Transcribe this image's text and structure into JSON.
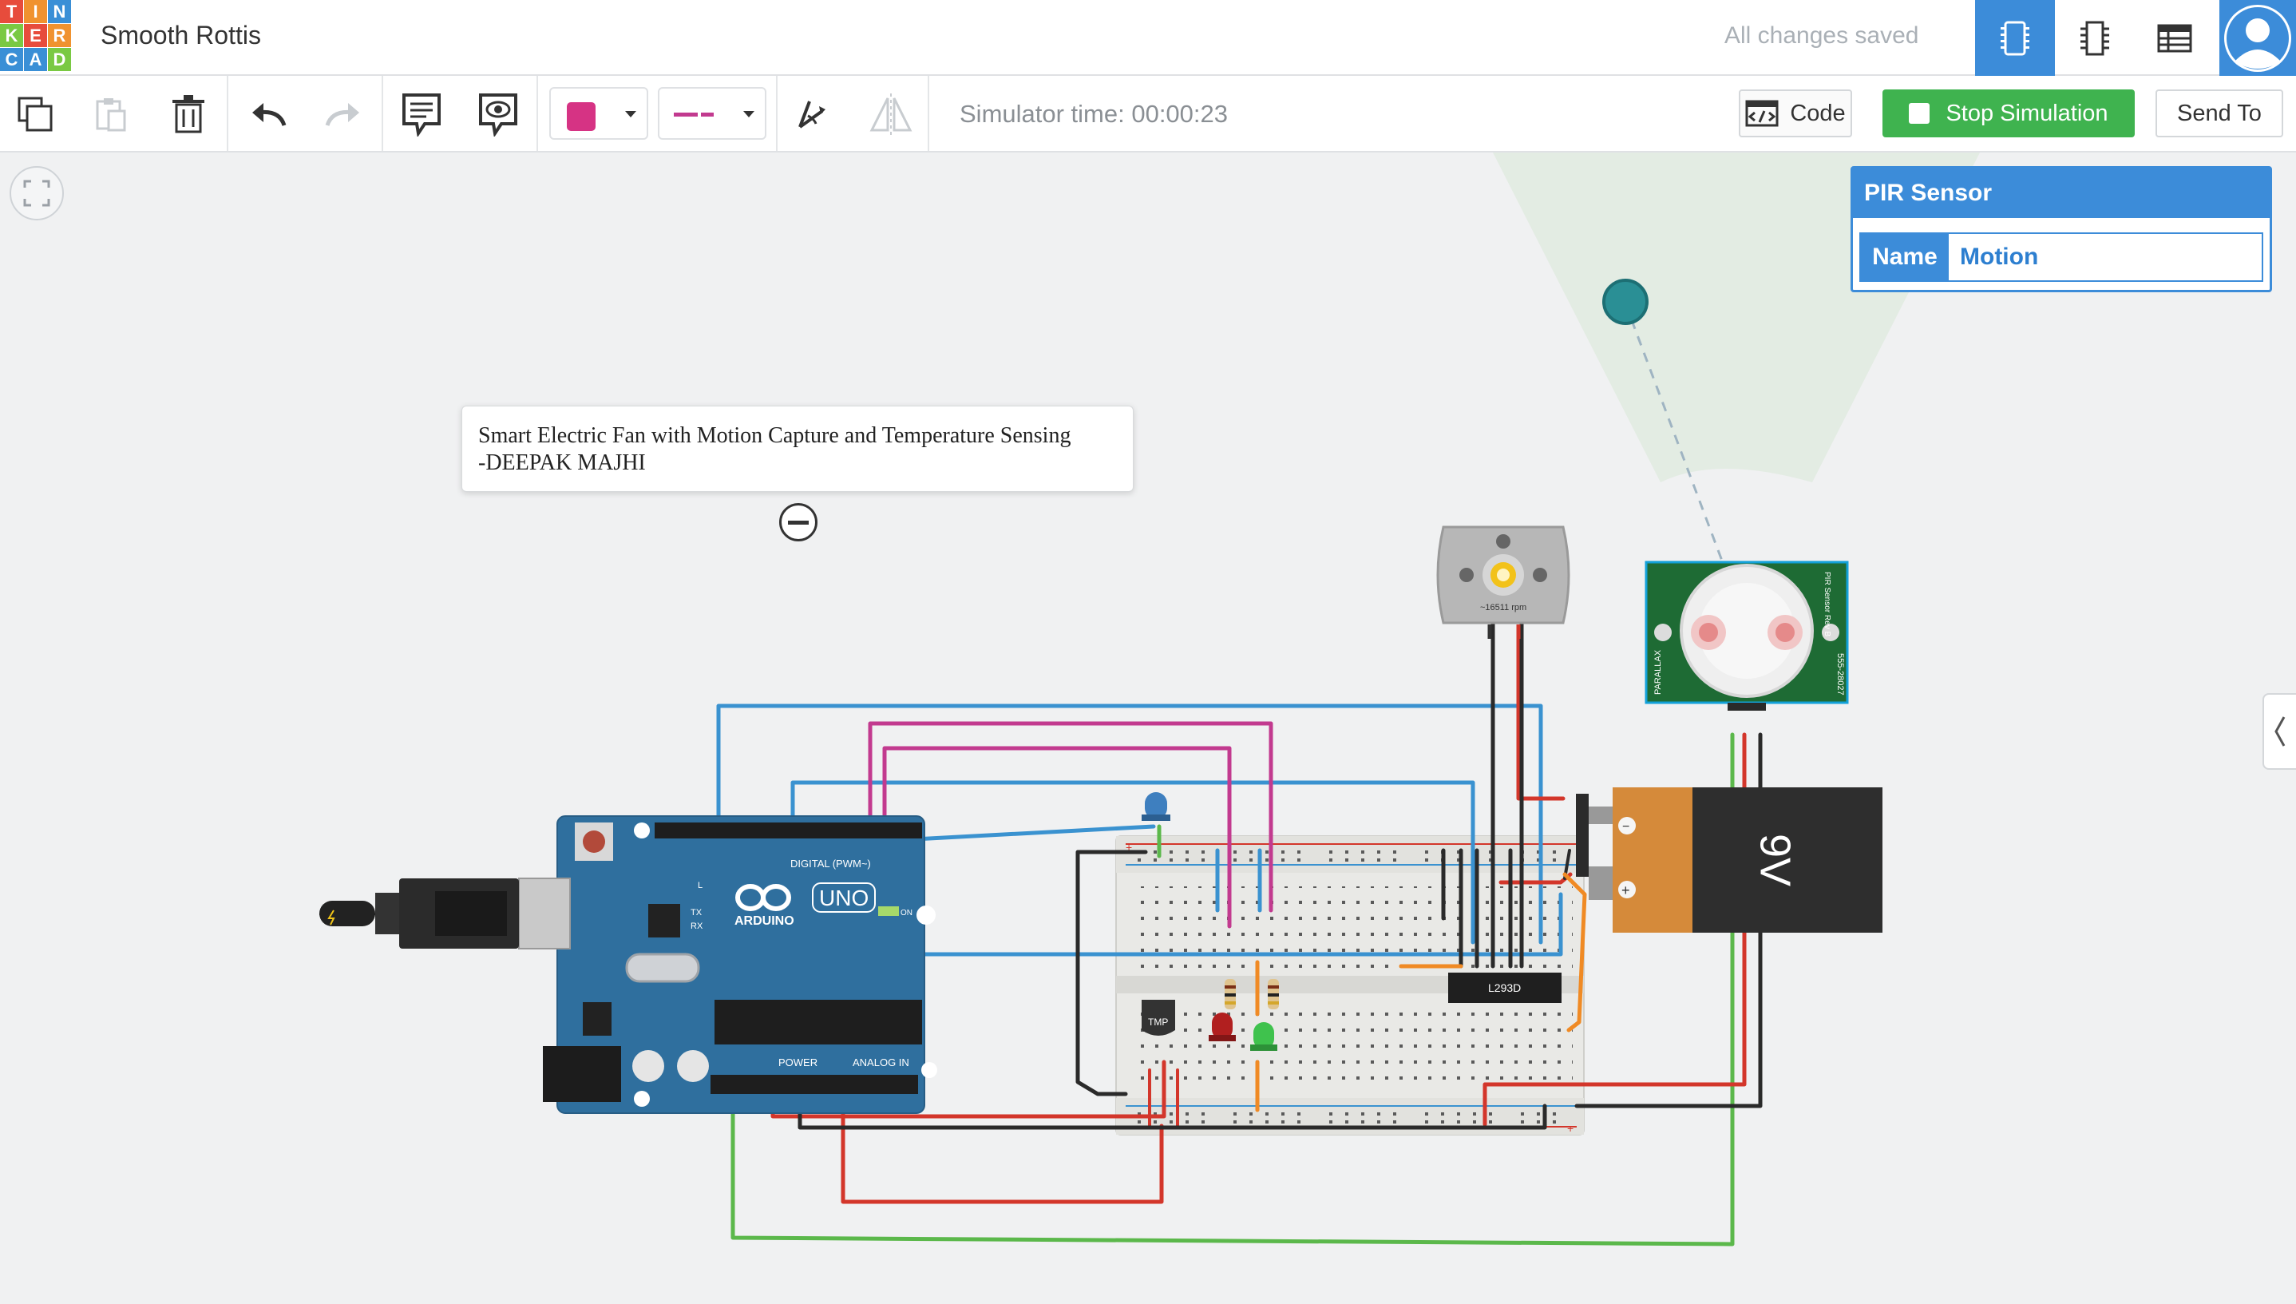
{
  "app": {
    "logo_letters": [
      "T",
      "I",
      "N",
      "K",
      "E",
      "R",
      "C",
      "A",
      "D"
    ],
    "title": "Smooth Rottis",
    "save_status": "All changes saved"
  },
  "header": {
    "views": [
      {
        "name": "circuit-view",
        "icon": "breadboard-icon",
        "active": true
      },
      {
        "name": "schematic-view",
        "icon": "chip-icon",
        "active": false
      },
      {
        "name": "component-list",
        "icon": "table-icon",
        "active": false
      }
    ],
    "avatar_icon": "user-icon"
  },
  "toolbar": {
    "tools": [
      "copy-icon",
      "paste-icon",
      "delete-icon",
      "undo-icon",
      "redo-icon",
      "notes-icon",
      "notes-visibility-icon"
    ],
    "wire_color": "#d63384",
    "simulator_time_label": "Simulator time: 00:00:23",
    "code_label": "Code",
    "stop_label": "Stop Simulation",
    "send_label": "Send To"
  },
  "note": {
    "line1": "Smart Electric Fan with Motion Capture and Temperature Sensing",
    "line2": "-DEEPAK MAJHI"
  },
  "inspector": {
    "title": "PIR Sensor",
    "field_label": "Name",
    "field_value": "Motion"
  },
  "components": {
    "arduino": {
      "brand": "ARDUINO",
      "model": "UNO",
      "digital_label": "DIGITAL (PWM~)",
      "power_label": "POWER",
      "analog_label": "ANALOG IN",
      "on_label": "ON",
      "tx": "TX",
      "rx": "RX",
      "l": "L"
    },
    "motor": {
      "rpm_label": "~16511 rpm"
    },
    "pir": {
      "side_left": "PARALLAX",
      "side_right": "555-28027",
      "top_right": "PIR Sensor Rev B"
    },
    "battery": {
      "label": "9V",
      "minus": "−",
      "plus": "+"
    },
    "driver_ic": {
      "label": "L293D"
    },
    "temp_sensor": {
      "label": "TMP"
    }
  },
  "colors": {
    "accent_blue": "#3c8cd9",
    "stop_green": "#3fb34f",
    "wire_blue": "#3a92d0",
    "wire_magenta": "#c23a8f",
    "wire_red": "#d3362b",
    "wire_green": "#5bb84b",
    "wire_black": "#2a2a2a",
    "wire_orange": "#f08a24"
  }
}
